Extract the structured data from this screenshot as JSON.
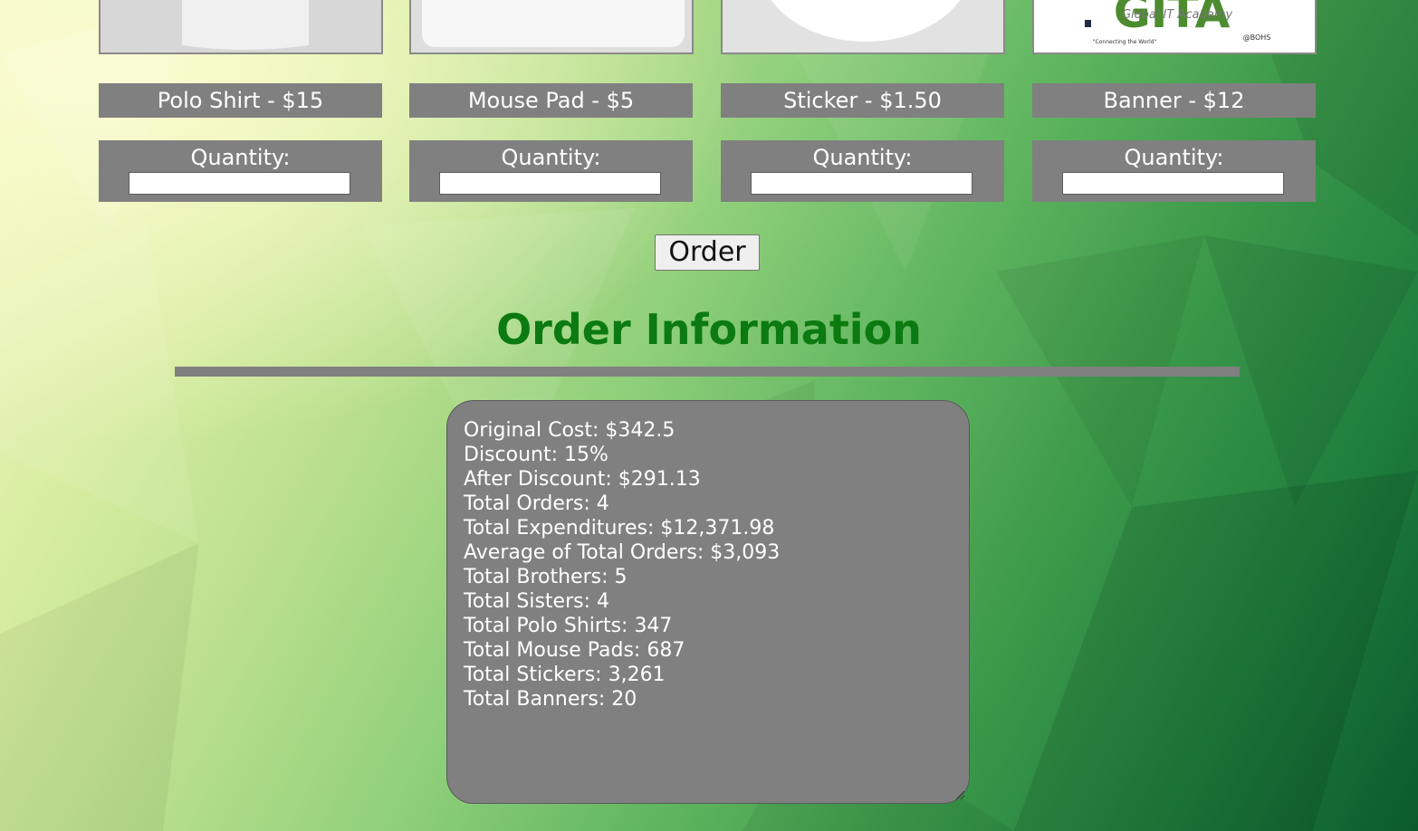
{
  "products": [
    {
      "label": "Polo Shirt - $15",
      "quantity_label": "Quantity:",
      "quantity_value": ""
    },
    {
      "label": "Mouse Pad - $5",
      "quantity_label": "Quantity:",
      "quantity_value": ""
    },
    {
      "label": "Sticker - $1.50",
      "quantity_label": "Quantity:",
      "quantity_value": ""
    },
    {
      "label": "Banner - $12",
      "quantity_label": "Quantity:",
      "quantity_value": ""
    }
  ],
  "banner_logo": {
    "letters": "GITA",
    "tagline": "Global IT Academy",
    "motto": "\"Connecting the World\"",
    "mark": "@BOHS"
  },
  "order_button_label": "Order",
  "order_info": {
    "title": "Order Information",
    "text": "Original Cost: $342.5\nDiscount: 15%\nAfter Discount: $291.13\nTotal Orders: 4\nTotal Expenditures: $12,371.98\nAverage of Total Orders: $3,093\nTotal Brothers: 5\nTotal Sisters: 4\nTotal Polo Shirts: 347\nTotal Mouse Pads: 687\nTotal Stickers: 3,261\nTotal Banners: 20"
  },
  "colors": {
    "title_green": "#0b7a11",
    "panel_gray": "#808080"
  }
}
